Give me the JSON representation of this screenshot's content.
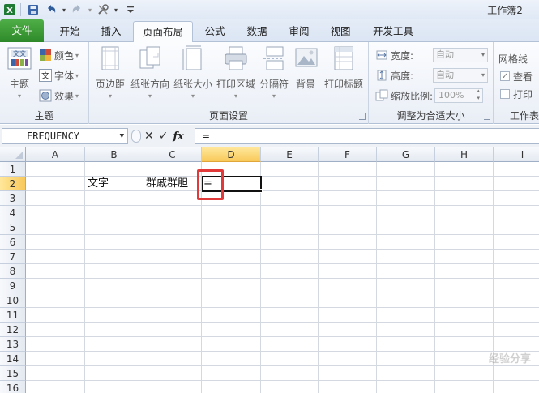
{
  "window": {
    "title": "工作簿2 -"
  },
  "quick_access": {
    "icons": [
      "excel-logo-icon",
      "save-icon",
      "undo-icon",
      "redo-icon",
      "tools-icon",
      "customize-icon"
    ]
  },
  "tabs": [
    {
      "label": "文件",
      "active": false
    },
    {
      "label": "开始",
      "active": false
    },
    {
      "label": "插入",
      "active": false
    },
    {
      "label": "页面布局",
      "active": true
    },
    {
      "label": "公式",
      "active": false
    },
    {
      "label": "数据",
      "active": false
    },
    {
      "label": "审阅",
      "active": false
    },
    {
      "label": "视图",
      "active": false
    },
    {
      "label": "开发工具",
      "active": false
    }
  ],
  "ribbon": {
    "theme_group": {
      "label": "主题",
      "big_button": "主题",
      "small": [
        "颜色",
        "字体",
        "效果"
      ]
    },
    "page_setup_group": {
      "label": "页面设置",
      "buttons": [
        "页边距",
        "纸张方向",
        "纸张大小",
        "打印区域",
        "分隔符",
        "背景",
        "打印标题"
      ]
    },
    "scale_group": {
      "label": "调整为合适大小",
      "width_label": "宽度:",
      "width_value": "自动",
      "height_label": "高度:",
      "height_value": "自动",
      "scale_label": "缩放比例:",
      "scale_value": "100%"
    },
    "sheet_options_group": {
      "label": "工作表",
      "gridlines_label": "网格线",
      "view_label": "查看",
      "print_label": "打印"
    }
  },
  "formula_bar": {
    "name_box": "FREQUENCY",
    "fx_label": "fx",
    "formula": "="
  },
  "sheet": {
    "columns": [
      "A",
      "B",
      "C",
      "D",
      "E",
      "F",
      "G",
      "H",
      "I"
    ],
    "rows": [
      "1",
      "2",
      "3",
      "4",
      "5",
      "6",
      "7",
      "8",
      "9",
      "10",
      "11",
      "12",
      "13",
      "14",
      "15",
      "16"
    ],
    "selected_column": "D",
    "selected_row": "2",
    "cells": {
      "B2": "文字",
      "C2": "群戚群胆",
      "D2": "="
    }
  },
  "watermark": "经验分享"
}
